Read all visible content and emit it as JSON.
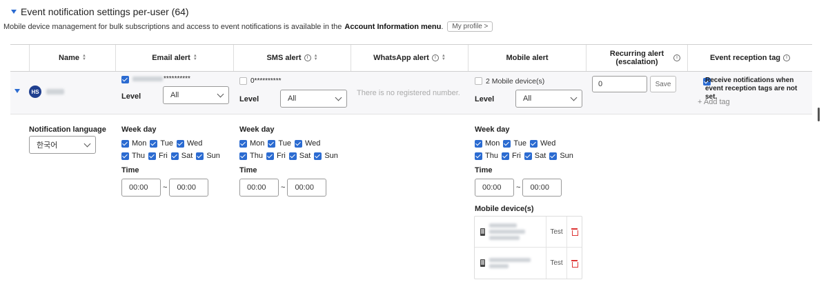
{
  "section": {
    "title": "Event notification settings per-user (64)",
    "description_prefix": "Mobile device management for bulk subscriptions and access to event notifications is available in the",
    "description_bold": "Account Information menu",
    "description_suffix": ".",
    "profile_button": "My profile >"
  },
  "columns": {
    "name": "Name",
    "email": "Email alert",
    "sms": "SMS alert",
    "whatsapp": "WhatsApp alert",
    "mobile": "Mobile alert",
    "recurring": "Recurring alert (escalation)",
    "tag": "Event reception tag"
  },
  "user": {
    "avatar": "HS",
    "email_masked": "**********",
    "email_level_label": "Level",
    "email_level_value": "All",
    "sms_value": "0**********",
    "sms_level_label": "Level",
    "sms_level_value": "All",
    "whatsapp_empty": "There is no registered number.",
    "mobile_value": "2 Mobile device(s)",
    "mobile_level_label": "Level",
    "mobile_level_value": "All",
    "recurring_value": "0",
    "save_label": "Save",
    "tag_checkbox_label": "Receive notifications when event reception tags are not set.",
    "add_tag": "+ Add tag"
  },
  "details": {
    "language_label": "Notification language",
    "language_value": "한국어",
    "weekday_label": "Week day",
    "time_label": "Time",
    "days": [
      "Mon",
      "Tue",
      "Wed",
      "Thu",
      "Fri",
      "Sat",
      "Sun"
    ],
    "time_from": "00:00",
    "time_to": "00:00",
    "tilde": "~",
    "devices_label": "Mobile device(s)",
    "test_label": "Test"
  },
  "colors": {
    "accent": "#2b6bd1",
    "avatar": "#1f3f8f",
    "delete": "#dd3333"
  }
}
